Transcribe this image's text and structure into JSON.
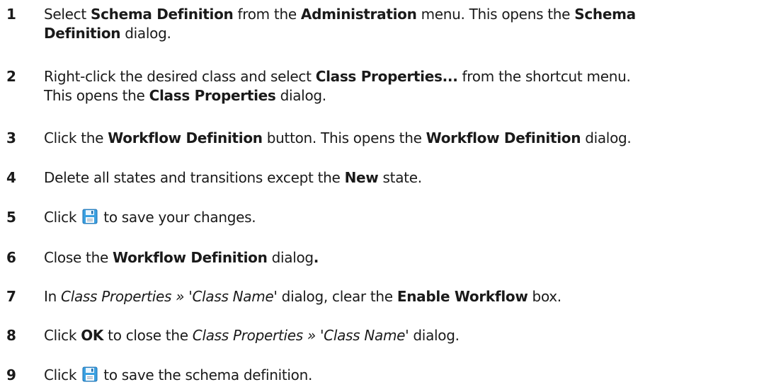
{
  "steps": [
    {
      "number": "1",
      "lines": [
        [
          {
            "t": "Select "
          },
          {
            "t": "Schema Definition",
            "style": "b"
          },
          {
            "t": " from the "
          },
          {
            "t": "Administration",
            "style": "b"
          },
          {
            "t": " menu. This opens the "
          },
          {
            "t": "Schema",
            "style": "b"
          }
        ],
        [
          {
            "t": "Definition",
            "style": "b"
          },
          {
            "t": " dialog."
          }
        ]
      ]
    },
    {
      "number": "2",
      "lines": [
        [
          {
            "t": "Right-click the desired class and select "
          },
          {
            "t": "Class Properties...",
            "style": "b"
          },
          {
            "t": " from the shortcut menu."
          }
        ],
        [
          {
            "t": "This opens the "
          },
          {
            "t": "Class Properties",
            "style": "b"
          },
          {
            "t": " dialog."
          }
        ]
      ]
    },
    {
      "number": "3",
      "lines": [
        [
          {
            "t": "Click the "
          },
          {
            "t": "Workflow Definition",
            "style": "b"
          },
          {
            "t": " button. This opens the "
          },
          {
            "t": "Workflow Definition",
            "style": "b"
          },
          {
            "t": " dialog."
          }
        ]
      ]
    },
    {
      "number": "4",
      "lines": [
        [
          {
            "t": "Delete all states and transitions except the "
          },
          {
            "t": "New",
            "style": "b"
          },
          {
            "t": " state."
          }
        ]
      ]
    },
    {
      "number": "5",
      "lines": [
        [
          {
            "t": "Click "
          },
          {
            "icon": "save-icon"
          },
          {
            "t": " to save your changes."
          }
        ]
      ]
    },
    {
      "number": "6",
      "lines": [
        [
          {
            "t": "Close the "
          },
          {
            "t": "Workflow Definition",
            "style": "b"
          },
          {
            "t": " dialog"
          },
          {
            "t": ".",
            "style": "b"
          }
        ]
      ]
    },
    {
      "number": "7",
      "lines": [
        [
          {
            "t": "In "
          },
          {
            "t": "Class Properties » 'Class Name'",
            "style": "i"
          },
          {
            "t": " dialog, clear the "
          },
          {
            "t": "Enable Workflow",
            "style": "b"
          },
          {
            "t": " box."
          }
        ]
      ]
    },
    {
      "number": "8",
      "lines": [
        [
          {
            "t": "Click "
          },
          {
            "t": "OK",
            "style": "b"
          },
          {
            "t": " to close the "
          },
          {
            "t": "Class Properties » 'Class Name'",
            "style": "i"
          },
          {
            "t": " dialog."
          }
        ]
      ]
    },
    {
      "number": "9",
      "lines": [
        [
          {
            "t": "Click "
          },
          {
            "icon": "save-icon"
          },
          {
            "t": " to save the schema definition."
          }
        ]
      ]
    }
  ]
}
